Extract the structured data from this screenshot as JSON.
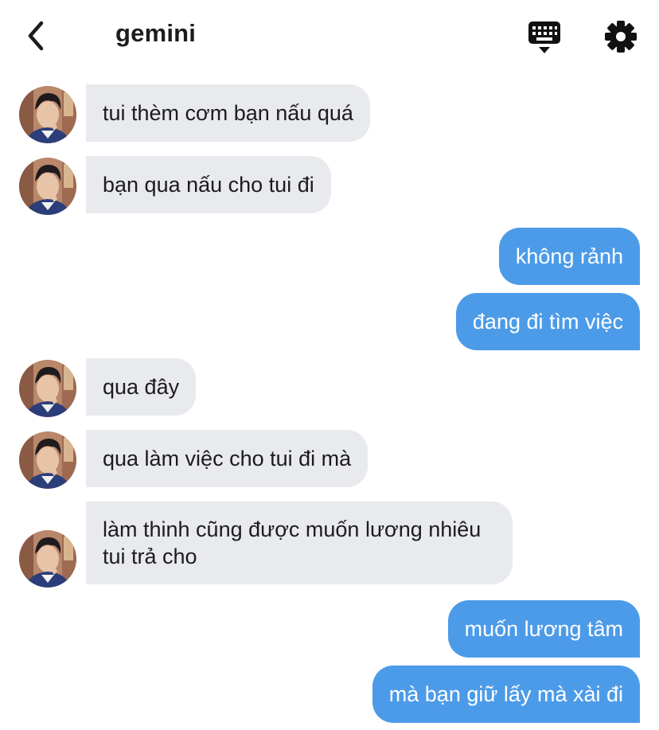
{
  "header": {
    "title": "gemini",
    "back_icon": "chevron-left-icon",
    "keyboard_icon": "keyboard-icon",
    "settings_icon": "gear-icon"
  },
  "colors": {
    "incoming_bubble": "#e8eaee",
    "outgoing_bubble": "#4c9be8",
    "text_dark": "#1c1c1e",
    "text_light": "#ffffff"
  },
  "messages": [
    {
      "from": "them",
      "text": "tui thèm cơm bạn nấu quá"
    },
    {
      "from": "them",
      "text": "bạn qua nấu cho tui đi"
    },
    {
      "from": "me",
      "text": "không rảnh"
    },
    {
      "from": "me",
      "text": "đang đi tìm việc"
    },
    {
      "from": "them",
      "text": "qua đây"
    },
    {
      "from": "them",
      "text": "qua làm việc cho tui đi mà"
    },
    {
      "from": "them",
      "text": "làm thinh cũng được muốn lương nhiêu tui trả cho"
    },
    {
      "from": "me",
      "text": "muốn lương tâm"
    },
    {
      "from": "me",
      "text": "mà bạn giữ lấy mà xài đi"
    }
  ]
}
